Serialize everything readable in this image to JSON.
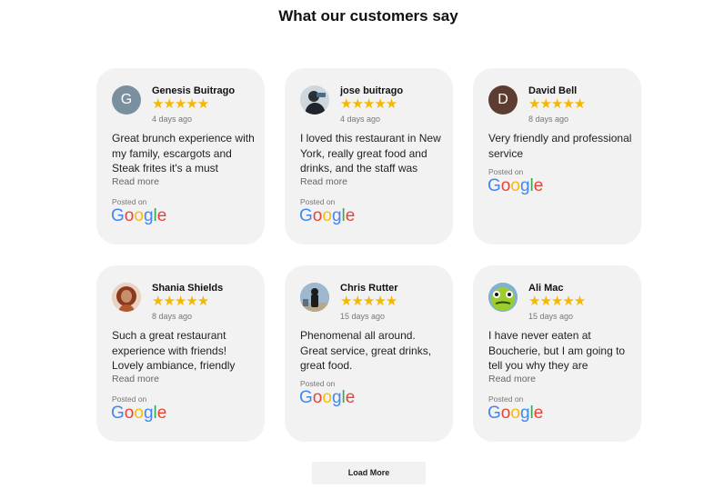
{
  "title": "What our customers say",
  "reviews": [
    {
      "name": "Genesis Buitrago",
      "avatar_letter": "G",
      "avatar_color": "#7b909e",
      "stars": "★★★★★",
      "date": "4 days ago",
      "text": "Great brunch experience with my family, escargots and Steak frites it's a must",
      "read_more": "Read more",
      "posted_on": "Posted on",
      "source": "Google"
    },
    {
      "name": "jose buitrago",
      "avatar_letter": "",
      "avatar_color": "#3a4a5a",
      "stars": "★★★★★",
      "date": "4 days ago",
      "text": "I loved this restaurant in New York, really great food and drinks, and the staff was",
      "read_more": "Read more",
      "posted_on": "Posted on",
      "source": "Google"
    },
    {
      "name": "David Bell",
      "avatar_letter": "D",
      "avatar_color": "#5d3d31",
      "stars": "★★★★★",
      "date": "8 days ago",
      "text": "Very friendly and professional service",
      "read_more": "",
      "posted_on": "Posted on",
      "source": "Google"
    },
    {
      "name": "Shania Shields",
      "avatar_letter": "",
      "avatar_color": "#a0522d",
      "stars": "★★★★★",
      "date": "8 days ago",
      "text": "Such a great restaurant experience with friends! Lovely ambiance, friendly",
      "read_more": "Read more",
      "posted_on": "Posted on",
      "source": "Google"
    },
    {
      "name": "Chris Rutter",
      "avatar_letter": "",
      "avatar_color": "#6f8aa8",
      "stars": "★★★★★",
      "date": "15 days ago",
      "text": "Phenomenal all around. Great service, great drinks, great food.",
      "read_more": "",
      "posted_on": "Posted on",
      "source": "Google"
    },
    {
      "name": "Ali Mac",
      "avatar_letter": "",
      "avatar_color": "#9ccc2e",
      "stars": "★★★★★",
      "date": "15 days ago",
      "text": "I have never eaten at Boucherie, but I am going to tell you why they are",
      "read_more": "Read more",
      "posted_on": "Posted on",
      "source": "Google"
    }
  ],
  "load_more": "Load More"
}
